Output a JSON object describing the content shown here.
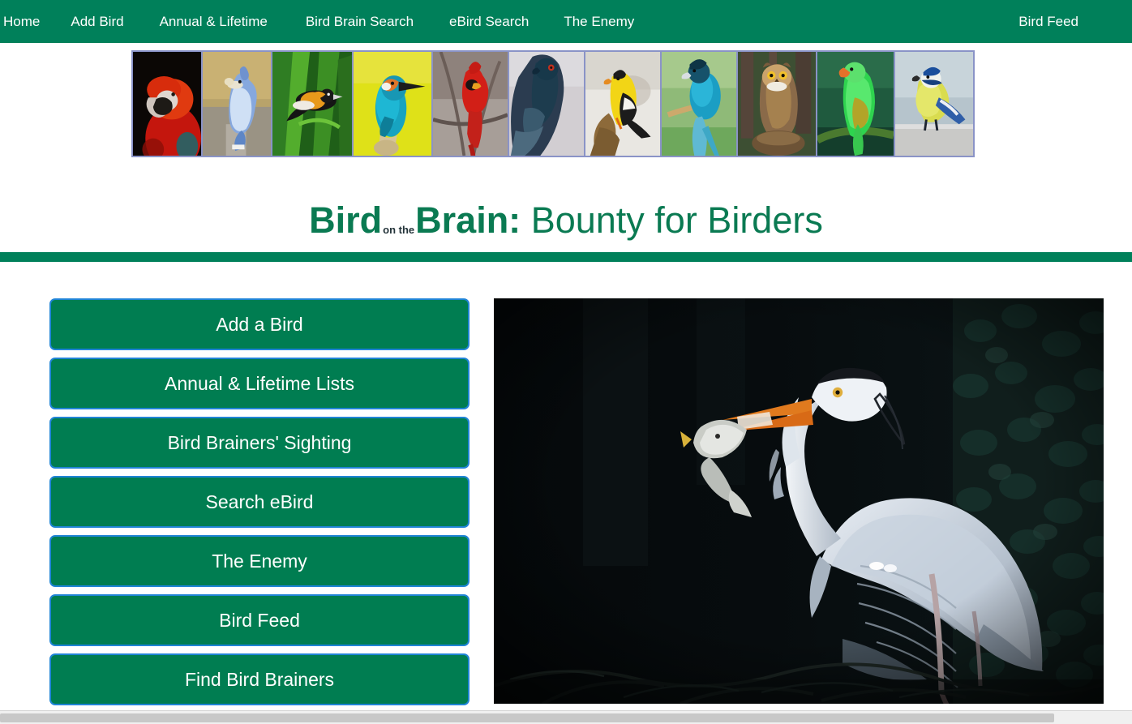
{
  "colors": {
    "brand_green": "#00805a",
    "button_green": "#007d51",
    "button_border_blue": "#1f84d6",
    "title_green": "#0a7a52",
    "thumb_border": "#8a93c7"
  },
  "navbar": {
    "left_items": [
      {
        "label": "Home",
        "name": "nav-home"
      },
      {
        "label": "Add Bird",
        "name": "nav-add-bird"
      },
      {
        "label": "Annual & Lifetime",
        "name": "nav-annual-lifetime"
      },
      {
        "label": "Bird Brain Search",
        "name": "nav-bird-brain-search"
      },
      {
        "label": "eBird Search",
        "name": "nav-ebird-search"
      },
      {
        "label": "The Enemy",
        "name": "nav-the-enemy"
      }
    ],
    "right_item": {
      "label": "Bird Feed",
      "name": "nav-bird-feed"
    }
  },
  "thumbnail_strip": {
    "count": 11,
    "items": [
      {
        "alt": "scarlet macaw",
        "name": "thumbnail-macaw"
      },
      {
        "alt": "blue jay with peanut",
        "name": "thumbnail-blue-jay"
      },
      {
        "alt": "hooded oriole on palm frond",
        "name": "thumbnail-oriole"
      },
      {
        "alt": "common kingfisher on yellow background",
        "name": "thumbnail-kingfisher"
      },
      {
        "alt": "northern cardinal on branch",
        "name": "thumbnail-cardinal"
      },
      {
        "alt": "dark blue pigeon",
        "name": "thumbnail-pigeon"
      },
      {
        "alt": "american goldfinch on stump",
        "name": "thumbnail-goldfinch"
      },
      {
        "alt": "blue paradise flycatcher",
        "name": "thumbnail-flycatcher"
      },
      {
        "alt": "great horned owl on stump",
        "name": "thumbnail-owl"
      },
      {
        "alt": "green parrot on mossy branch",
        "name": "thumbnail-parrot"
      },
      {
        "alt": "eurasian blue tit on snowy ledge",
        "name": "thumbnail-blue-tit"
      }
    ]
  },
  "title": {
    "part1": "Bird",
    "small": "on the",
    "part2": "Brain:",
    "part3": "Bounty for Birders"
  },
  "menu": {
    "buttons": [
      {
        "label": "Add a Bird",
        "name": "menu-button-add-a-bird"
      },
      {
        "label": "Annual & Lifetime Lists",
        "name": "menu-button-annual-lifetime-lists"
      },
      {
        "label": "Bird Brainers' Sighting",
        "name": "menu-button-bird-brainers-sighting"
      },
      {
        "label": "Search eBird",
        "name": "menu-button-search-ebird"
      },
      {
        "label": "The Enemy",
        "name": "menu-button-the-enemy"
      },
      {
        "label": "Bird Feed",
        "name": "menu-button-bird-feed"
      },
      {
        "label": "Find Bird Brainers",
        "name": "menu-button-find-bird-brainers"
      }
    ]
  },
  "hero": {
    "alt": "grey heron holding a fish in its beak at night beside an ivy covered tree"
  }
}
